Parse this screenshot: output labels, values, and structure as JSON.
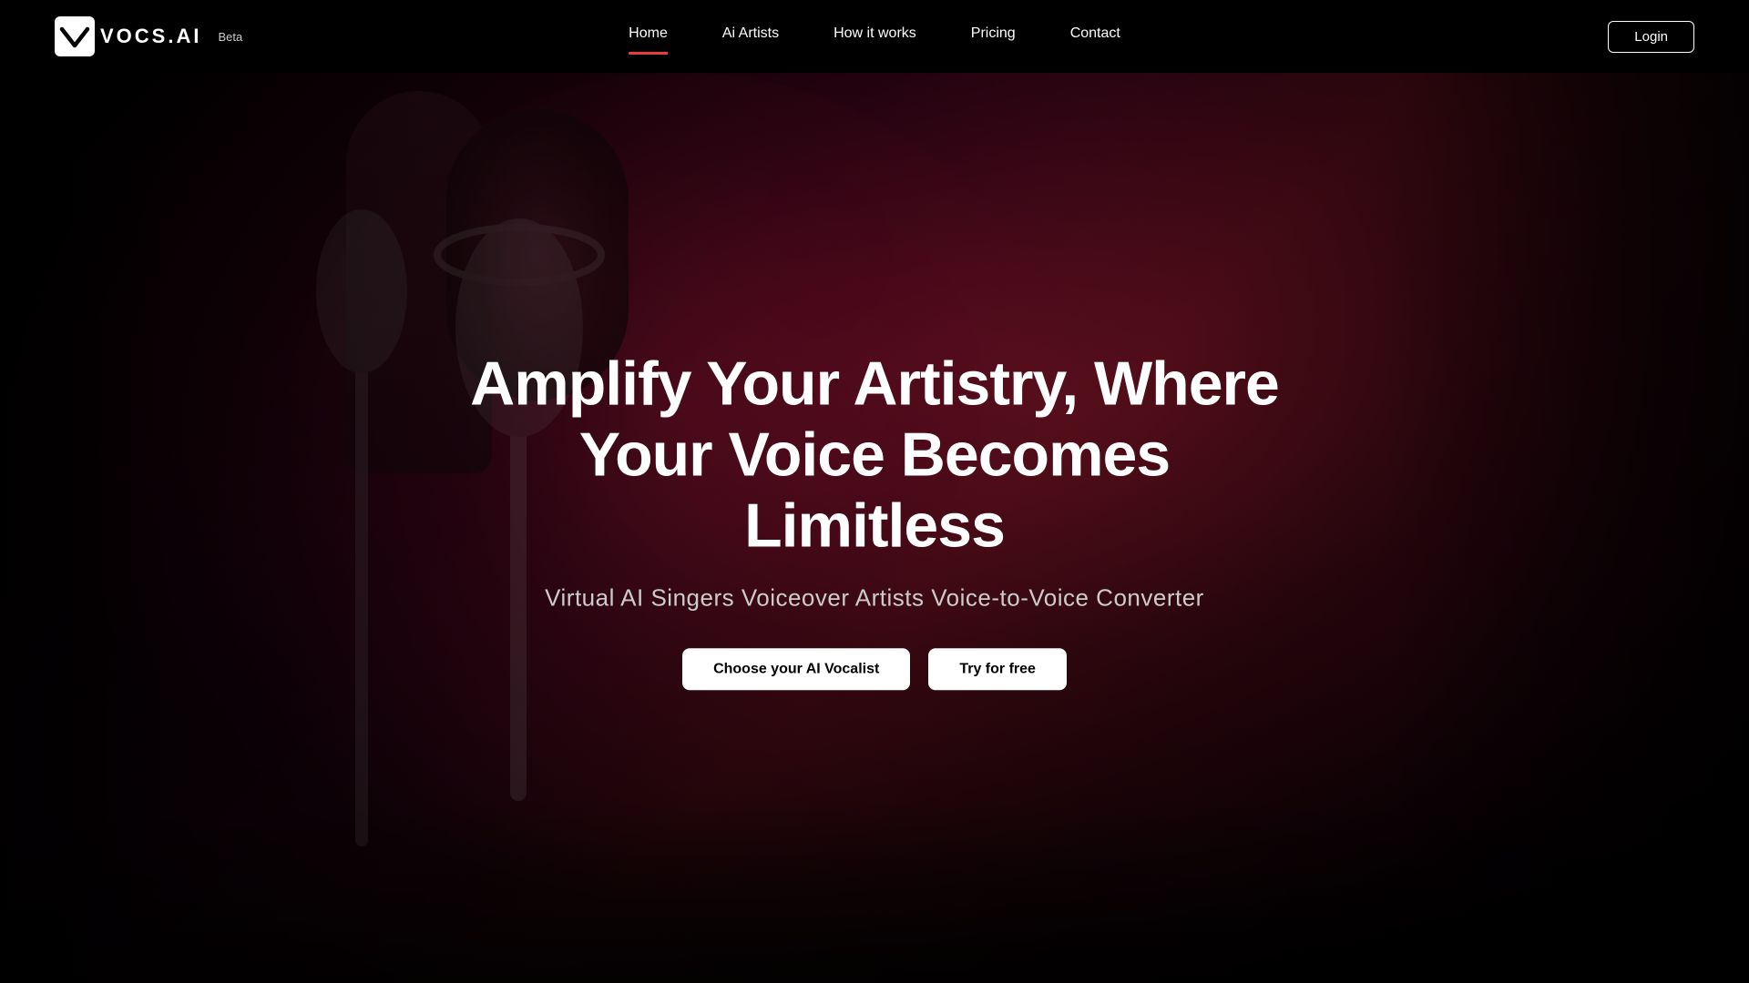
{
  "navbar": {
    "logo_text": "VOCS.AI",
    "beta_label": "Beta",
    "nav_items": [
      {
        "label": "Home",
        "active": true
      },
      {
        "label": "Ai Artists",
        "active": false
      },
      {
        "label": "How it works",
        "active": false
      },
      {
        "label": "Pricing",
        "active": false
      },
      {
        "label": "Contact",
        "active": false
      }
    ],
    "login_label": "Login"
  },
  "hero": {
    "title_line1": "Amplify Your Artistry, Where",
    "title_line2": "Your Voice Becomes Limitless",
    "subtitle": "Virtual AI Singers  Voiceover Artists  Voice-to-Voice Converter",
    "cta_choose": "Choose your AI Vocalist",
    "cta_try": "Try for free"
  }
}
